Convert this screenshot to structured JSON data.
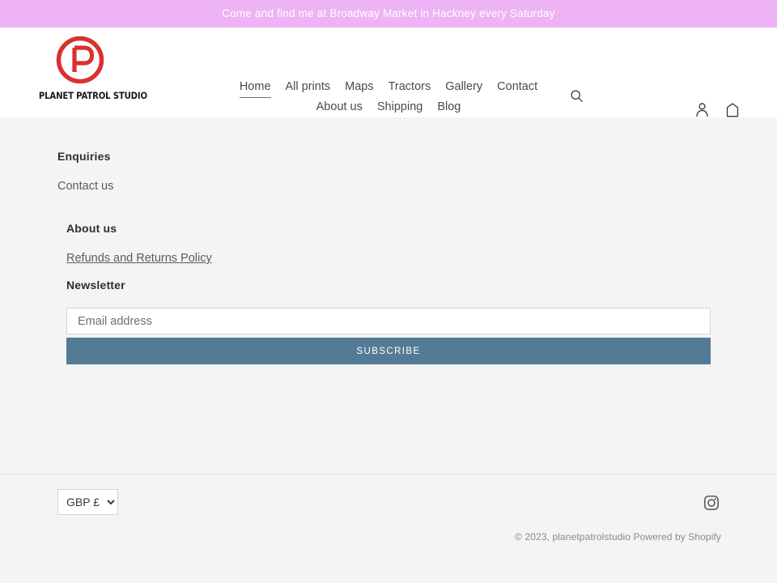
{
  "announcement": {
    "text": "Come and find me at Broadway Market in Hackney every Saturday"
  },
  "header": {
    "logo": {
      "wordmark": "PLANET PATROL STUDIO",
      "mark_letter": "P",
      "mark_color": "#d8322f",
      "icon": "planet-patrol-logo"
    },
    "nav_row_1": [
      {
        "label": "Home",
        "active": true
      },
      {
        "label": "All prints",
        "active": false
      },
      {
        "label": "Maps",
        "active": false
      },
      {
        "label": "Tractors",
        "active": false
      },
      {
        "label": "Gallery",
        "active": false
      },
      {
        "label": "Contact",
        "active": false
      }
    ],
    "nav_row_2": [
      {
        "label": "About us",
        "active": false
      },
      {
        "label": "Shipping",
        "active": false
      },
      {
        "label": "Blog",
        "active": false
      }
    ],
    "search_icon": "search-icon",
    "account_icon": "account-icon",
    "cart_icon": "shopping-bag-icon"
  },
  "footer": {
    "enquiries": {
      "heading": "Enquiries",
      "link": "Contact us"
    },
    "about": {
      "heading": "About us",
      "link": "Refunds and Returns Policy"
    },
    "newsletter": {
      "heading": "Newsletter",
      "email_placeholder": "Email address",
      "email_value": "",
      "subscribe_label": "SUBSCRIBE",
      "subscribe_color": "#547b96"
    },
    "bottom": {
      "currency_selected": "GBP £",
      "currency_options": [
        "GBP £"
      ],
      "social_icon": "instagram-icon",
      "copyright": "© 2023, planetpatrolstudio",
      "powered_by": "Powered by Shopify"
    }
  }
}
